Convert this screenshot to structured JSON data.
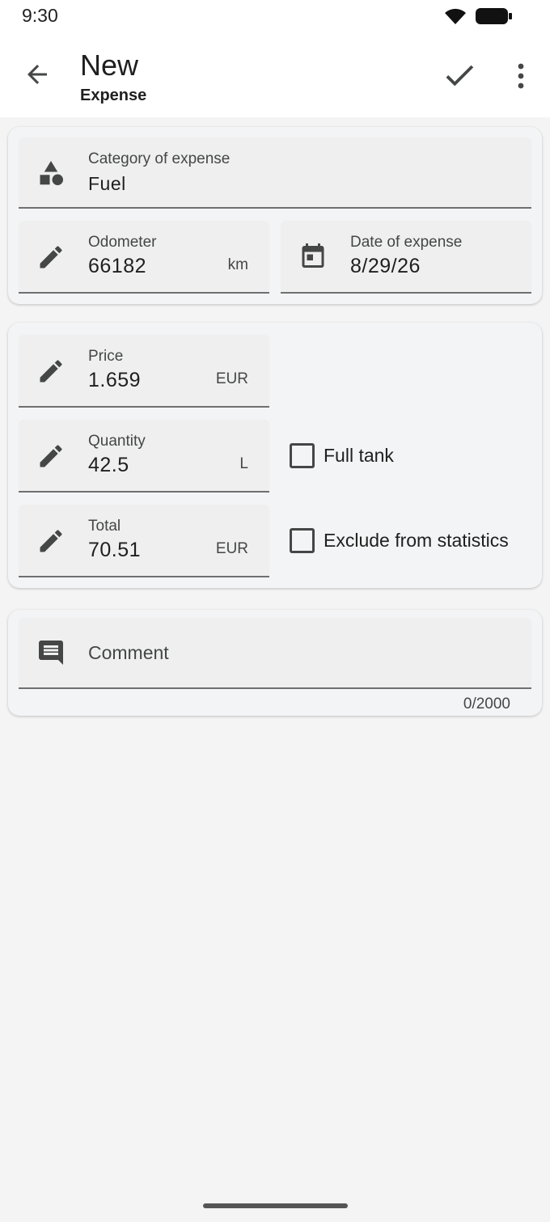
{
  "status_bar": {
    "time": "9:30"
  },
  "app_bar": {
    "title": "New",
    "subtitle": "Expense"
  },
  "category": {
    "label": "Category of expense",
    "value": "Fuel"
  },
  "odometer": {
    "label": "Odometer",
    "value": "66182",
    "unit": "km"
  },
  "date": {
    "label": "Date of expense",
    "value": "8/29/26"
  },
  "price": {
    "label": "Price",
    "value": "1.659",
    "unit": "EUR"
  },
  "quantity": {
    "label": "Quantity",
    "value": "42.5",
    "unit": "L"
  },
  "total": {
    "label": "Total",
    "value": "70.51",
    "unit": "EUR"
  },
  "full_tank": {
    "label": "Full tank",
    "checked": false
  },
  "exclude_stats": {
    "label": "Exclude from statistics",
    "checked": false
  },
  "comment": {
    "placeholder": "Comment",
    "counter": "0/2000"
  },
  "colors": {
    "icon": "#444746",
    "card": "#f3f4f5",
    "background": "#f4f4f4"
  }
}
